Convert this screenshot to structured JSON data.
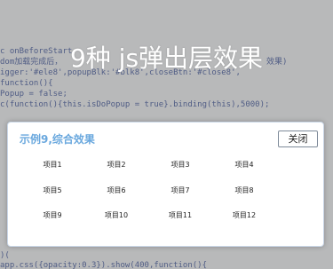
{
  "background_code": [
    "c onBeforeStart",
    "dom加载完成后，",
    "igger:'#ele8',popupBlk:'#blk8',closeBtn:'#close8',",
    "function(){",
    "Popup = false;",
    "c(function(){this.isDoPopup = true}.binding(this),5000);",
    ")(",
    "app.css({opacity:0.3}).show(400,function(){"
  ],
  "background_code_fragment_right": "效果)",
  "banner": {
    "title": "9种 js弹出层效果"
  },
  "popup": {
    "title": "示例9,综合效果",
    "close_label": "关闭",
    "items": [
      "项目1",
      "项目2",
      "项目3",
      "项目4",
      "项目5",
      "项目6",
      "项目7",
      "项目8",
      "项目9",
      "项目10",
      "项目11",
      "项目12"
    ]
  },
  "colors": {
    "overlay": "#3c3c3c",
    "popup_title": "#6aa8de",
    "popup_border": "#c9d6e6",
    "code_text": "#5a6da8"
  }
}
